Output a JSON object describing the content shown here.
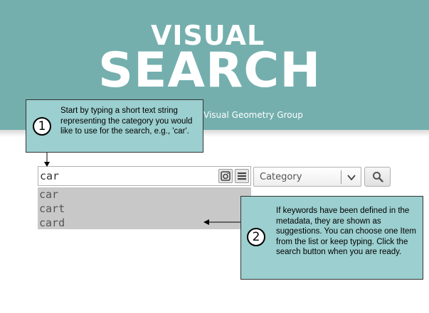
{
  "header": {
    "title_top": "VISUAL",
    "title_main": "SEARCH",
    "subtitle": "Visual Geometry Group",
    "background_color": "#74afae"
  },
  "search": {
    "value": "car",
    "camera_icon": "camera-icon",
    "menu_icon": "menu-icon"
  },
  "category": {
    "selected": "Category",
    "chevron_icon": "chevron-down-icon"
  },
  "search_button": {
    "icon": "magnifier-icon"
  },
  "suggestions": [
    "car",
    "cart",
    "card"
  ],
  "callouts": [
    {
      "number": "1",
      "text": "Start by typing a short text string representing the category you would like to use for the search, e.g., 'car'."
    },
    {
      "number": "2",
      "text": "If keywords have been defined in the metadata, they are shown as suggestions. You can choose one Item from the list or keep typing. Click the search button when you are ready."
    }
  ],
  "colors": {
    "callout_bg": "#9ccfcf",
    "suggestion_bg": "#c8c8c8"
  }
}
